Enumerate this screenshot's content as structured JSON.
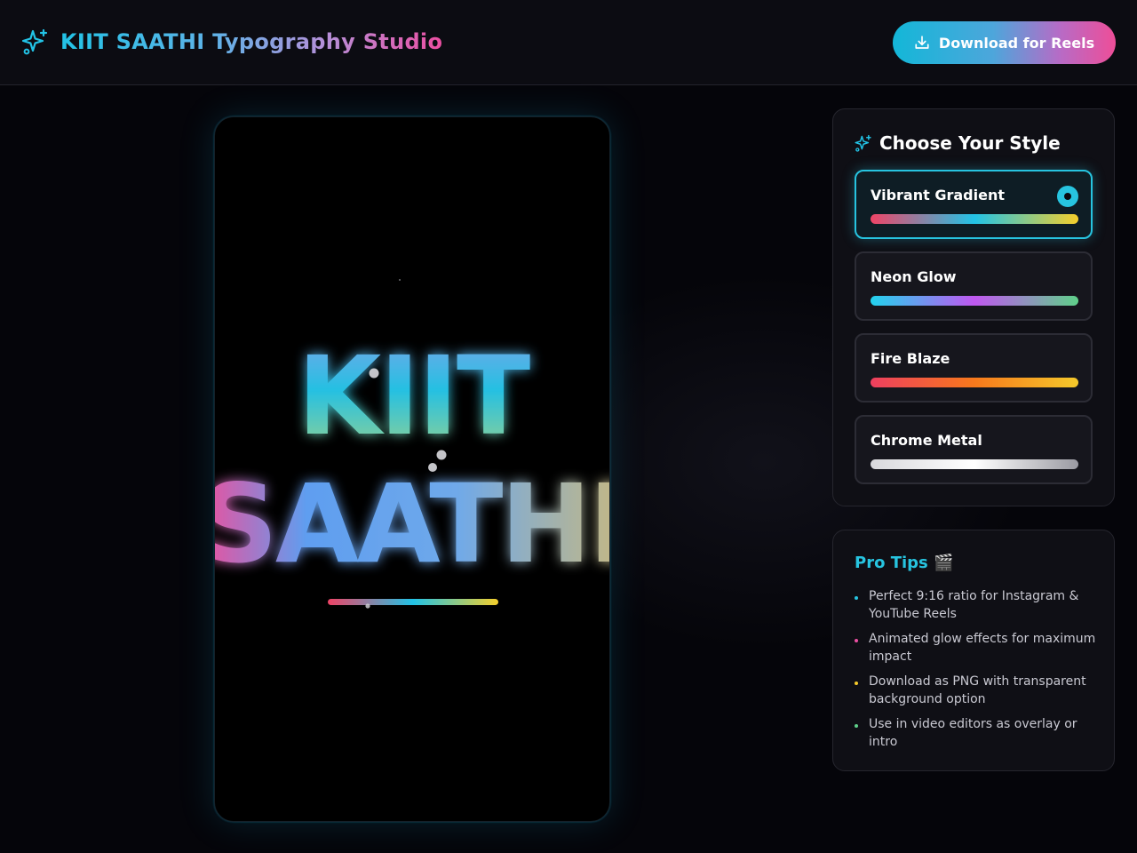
{
  "header": {
    "title": "KIIT SAATHI Typography Studio",
    "download_label": "Download for Reels"
  },
  "preview": {
    "line1": "KIIT",
    "line2": "SAATHI"
  },
  "styles": {
    "title": "Choose Your Style",
    "items": [
      {
        "label": "Vibrant Gradient",
        "selected": true,
        "colors": [
          "#ef4466",
          "#22c3e6",
          "#f5cf2b"
        ]
      },
      {
        "label": "Neon Glow",
        "selected": false,
        "colors": [
          "#22d3ee",
          "#c058f0",
          "#5fd08a"
        ]
      },
      {
        "label": "Fire Blaze",
        "selected": false,
        "colors": [
          "#ee3f5f",
          "#f7791c",
          "#f5c92b"
        ]
      },
      {
        "label": "Chrome Metal",
        "selected": false,
        "colors": [
          "#d8d8dc",
          "#ffffff",
          "#9a9aa2"
        ]
      }
    ]
  },
  "tips": {
    "title": "Pro Tips 🎬",
    "items": [
      {
        "text": "Perfect 9:16 ratio for Instagram & YouTube Reels",
        "color": "#27c4e0"
      },
      {
        "text": "Animated glow effects for maximum impact",
        "color": "#ec4fa2"
      },
      {
        "text": "Download as PNG with transparent background option",
        "color": "#f5c92b"
      },
      {
        "text": "Use in video editors as overlay or intro",
        "color": "#5fd08a"
      }
    ]
  },
  "colors": {
    "accent": "#27c4e0",
    "pink": "#ec4fa2",
    "background": "#05050a"
  }
}
